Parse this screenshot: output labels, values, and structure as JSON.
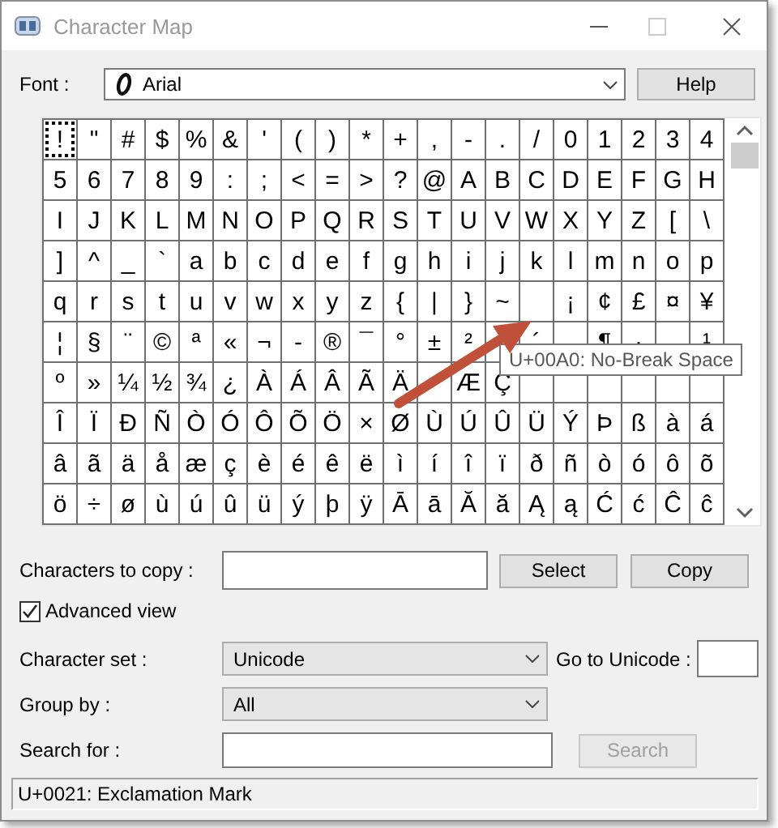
{
  "window": {
    "title": "Character Map"
  },
  "font": {
    "label": "Font :",
    "value": "Arial"
  },
  "help_button": {
    "label": "Help"
  },
  "grid": {
    "rows": [
      {
        "cells": [
          {
            "char": "!",
            "selected": true
          },
          {
            "char": "\"",
            "selected": false
          },
          {
            "char": "#",
            "selected": false
          },
          {
            "char": "$",
            "selected": false
          },
          {
            "char": "%",
            "selected": false
          },
          {
            "char": "&",
            "selected": false
          },
          {
            "char": "'",
            "selected": false
          },
          {
            "char": "(",
            "selected": false
          },
          {
            "char": ")",
            "selected": false
          },
          {
            "char": "*",
            "selected": false
          },
          {
            "char": "+",
            "selected": false
          },
          {
            "char": ",",
            "selected": false
          },
          {
            "char": "-",
            "selected": false
          },
          {
            "char": ".",
            "selected": false
          },
          {
            "char": "/",
            "selected": false
          },
          {
            "char": "0",
            "selected": false
          },
          {
            "char": "1",
            "selected": false
          },
          {
            "char": "2",
            "selected": false
          },
          {
            "char": "3",
            "selected": false
          },
          {
            "char": "4",
            "selected": false
          }
        ]
      },
      {
        "cells": [
          {
            "char": "5",
            "selected": false
          },
          {
            "char": "6",
            "selected": false
          },
          {
            "char": "7",
            "selected": false
          },
          {
            "char": "8",
            "selected": false
          },
          {
            "char": "9",
            "selected": false
          },
          {
            "char": ":",
            "selected": false
          },
          {
            "char": ";",
            "selected": false
          },
          {
            "char": "<",
            "selected": false
          },
          {
            "char": "=",
            "selected": false
          },
          {
            "char": ">",
            "selected": false
          },
          {
            "char": "?",
            "selected": false
          },
          {
            "char": "@",
            "selected": false
          },
          {
            "char": "A",
            "selected": false
          },
          {
            "char": "B",
            "selected": false
          },
          {
            "char": "C",
            "selected": false
          },
          {
            "char": "D",
            "selected": false
          },
          {
            "char": "E",
            "selected": false
          },
          {
            "char": "F",
            "selected": false
          },
          {
            "char": "G",
            "selected": false
          },
          {
            "char": "H",
            "selected": false
          }
        ]
      },
      {
        "cells": [
          {
            "char": "I",
            "selected": false
          },
          {
            "char": "J",
            "selected": false
          },
          {
            "char": "K",
            "selected": false
          },
          {
            "char": "L",
            "selected": false
          },
          {
            "char": "M",
            "selected": false
          },
          {
            "char": "N",
            "selected": false
          },
          {
            "char": "O",
            "selected": false
          },
          {
            "char": "P",
            "selected": false
          },
          {
            "char": "Q",
            "selected": false
          },
          {
            "char": "R",
            "selected": false
          },
          {
            "char": "S",
            "selected": false
          },
          {
            "char": "T",
            "selected": false
          },
          {
            "char": "U",
            "selected": false
          },
          {
            "char": "V",
            "selected": false
          },
          {
            "char": "W",
            "selected": false
          },
          {
            "char": "X",
            "selected": false
          },
          {
            "char": "Y",
            "selected": false
          },
          {
            "char": "Z",
            "selected": false
          },
          {
            "char": "[",
            "selected": false
          },
          {
            "char": "\\",
            "selected": false
          }
        ]
      },
      {
        "cells": [
          {
            "char": "]",
            "selected": false
          },
          {
            "char": "^",
            "selected": false
          },
          {
            "char": "_",
            "selected": false
          },
          {
            "char": "`",
            "selected": false
          },
          {
            "char": "a",
            "selected": false
          },
          {
            "char": "b",
            "selected": false
          },
          {
            "char": "c",
            "selected": false
          },
          {
            "char": "d",
            "selected": false
          },
          {
            "char": "e",
            "selected": false
          },
          {
            "char": "f",
            "selected": false
          },
          {
            "char": "g",
            "selected": false
          },
          {
            "char": "h",
            "selected": false
          },
          {
            "char": "i",
            "selected": false
          },
          {
            "char": "j",
            "selected": false
          },
          {
            "char": "k",
            "selected": false
          },
          {
            "char": "l",
            "selected": false
          },
          {
            "char": "m",
            "selected": false
          },
          {
            "char": "n",
            "selected": false
          },
          {
            "char": "o",
            "selected": false
          },
          {
            "char": "p",
            "selected": false
          }
        ]
      },
      {
        "cells": [
          {
            "char": "q",
            "selected": false
          },
          {
            "char": "r",
            "selected": false
          },
          {
            "char": "s",
            "selected": false
          },
          {
            "char": "t",
            "selected": false
          },
          {
            "char": "u",
            "selected": false
          },
          {
            "char": "v",
            "selected": false
          },
          {
            "char": "w",
            "selected": false
          },
          {
            "char": "x",
            "selected": false
          },
          {
            "char": "y",
            "selected": false
          },
          {
            "char": "z",
            "selected": false
          },
          {
            "char": "{",
            "selected": false
          },
          {
            "char": "|",
            "selected": false
          },
          {
            "char": "}",
            "selected": false
          },
          {
            "char": "~",
            "selected": false
          },
          {
            "selected": false
          },
          {
            "char": "¡",
            "selected": false
          },
          {
            "char": "¢",
            "selected": false
          },
          {
            "char": "£",
            "selected": false
          },
          {
            "char": "¤",
            "selected": false
          },
          {
            "char": "¥",
            "selected": false
          }
        ]
      },
      {
        "cells": [
          {
            "char": "¦",
            "selected": false
          },
          {
            "char": "§",
            "selected": false
          },
          {
            "char": "¨",
            "selected": false
          },
          {
            "char": "©",
            "selected": false
          },
          {
            "char": "ª",
            "selected": false
          },
          {
            "char": "«",
            "selected": false
          },
          {
            "char": "¬",
            "selected": false
          },
          {
            "char": "-",
            "selected": false
          },
          {
            "char": "®",
            "selected": false
          },
          {
            "char": "¯",
            "selected": false
          },
          {
            "char": "°",
            "selected": false
          },
          {
            "char": "±",
            "selected": false
          },
          {
            "char": "²",
            "selected": false
          },
          {
            "selected": false
          },
          {
            "char": "´",
            "selected": false
          },
          {
            "selected": false
          },
          {
            "char": "¶",
            "selected": false
          },
          {
            "char": "·",
            "selected": false
          },
          {
            "selected": false
          },
          {
            "char": "¹",
            "selected": false
          }
        ]
      },
      {
        "cells": [
          {
            "char": "º",
            "selected": false
          },
          {
            "char": "»",
            "selected": false
          },
          {
            "char": "¼",
            "selected": false
          },
          {
            "char": "½",
            "selected": false
          },
          {
            "char": "¾",
            "selected": false
          },
          {
            "char": "¿",
            "selected": false
          },
          {
            "char": "À",
            "selected": false
          },
          {
            "char": "Á",
            "selected": false
          },
          {
            "char": "Â",
            "selected": false
          },
          {
            "char": "Ã",
            "selected": false
          },
          {
            "char": "Ä",
            "selected": false
          },
          {
            "selected": false
          },
          {
            "char": "Æ",
            "selected": false
          },
          {
            "char": "Ç",
            "selected": false
          },
          {
            "selected": false
          },
          {
            "selected": false
          },
          {
            "selected": false
          },
          {
            "selected": false
          },
          {
            "selected": false
          },
          {
            "selected": false
          }
        ]
      },
      {
        "cells": [
          {
            "char": "Î",
            "selected": false
          },
          {
            "char": "Ï",
            "selected": false
          },
          {
            "char": "Ð",
            "selected": false
          },
          {
            "char": "Ñ",
            "selected": false
          },
          {
            "char": "Ò",
            "selected": false
          },
          {
            "char": "Ó",
            "selected": false
          },
          {
            "char": "Ô",
            "selected": false
          },
          {
            "char": "Õ",
            "selected": false
          },
          {
            "char": "Ö",
            "selected": false
          },
          {
            "char": "×",
            "selected": false
          },
          {
            "char": "Ø",
            "selected": false
          },
          {
            "char": "Ù",
            "selected": false
          },
          {
            "char": "Ú",
            "selected": false
          },
          {
            "char": "Û",
            "selected": false
          },
          {
            "char": "Ü",
            "selected": false
          },
          {
            "char": "Ý",
            "selected": false
          },
          {
            "char": "Þ",
            "selected": false
          },
          {
            "char": "ß",
            "selected": false
          },
          {
            "char": "à",
            "selected": false
          },
          {
            "char": "á",
            "selected": false
          }
        ]
      },
      {
        "cells": [
          {
            "char": "â",
            "selected": false
          },
          {
            "char": "ã",
            "selected": false
          },
          {
            "char": "ä",
            "selected": false
          },
          {
            "char": "å",
            "selected": false
          },
          {
            "char": "æ",
            "selected": false
          },
          {
            "char": "ç",
            "selected": false
          },
          {
            "char": "è",
            "selected": false
          },
          {
            "char": "é",
            "selected": false
          },
          {
            "char": "ê",
            "selected": false
          },
          {
            "char": "ë",
            "selected": false
          },
          {
            "char": "ì",
            "selected": false
          },
          {
            "char": "í",
            "selected": false
          },
          {
            "char": "î",
            "selected": false
          },
          {
            "char": "ï",
            "selected": false
          },
          {
            "char": "ð",
            "selected": false
          },
          {
            "char": "ñ",
            "selected": false
          },
          {
            "char": "ò",
            "selected": false
          },
          {
            "char": "ó",
            "selected": false
          },
          {
            "char": "ô",
            "selected": false
          },
          {
            "char": "õ",
            "selected": false
          }
        ]
      },
      {
        "cells": [
          {
            "char": "ö",
            "selected": false
          },
          {
            "char": "÷",
            "selected": false
          },
          {
            "char": "ø",
            "selected": false
          },
          {
            "char": "ù",
            "selected": false
          },
          {
            "char": "ú",
            "selected": false
          },
          {
            "char": "û",
            "selected": false
          },
          {
            "char": "ü",
            "selected": false
          },
          {
            "char": "ý",
            "selected": false
          },
          {
            "char": "þ",
            "selected": false
          },
          {
            "char": "ÿ",
            "selected": false
          },
          {
            "char": "Ā",
            "selected": false
          },
          {
            "char": "ā",
            "selected": false
          },
          {
            "char": "Ă",
            "selected": false
          },
          {
            "char": "ă",
            "selected": false
          },
          {
            "char": "Ą",
            "selected": false
          },
          {
            "char": "ą",
            "selected": false
          },
          {
            "char": "Ć",
            "selected": false
          },
          {
            "char": "ć",
            "selected": false
          },
          {
            "char": "Ĉ",
            "selected": false
          },
          {
            "char": "ĉ",
            "selected": false
          }
        ]
      }
    ]
  },
  "tooltip": "U+00A0: No-Break Space",
  "characters_to_copy": {
    "label": "Characters to copy :"
  },
  "select_button": {
    "label": "Select"
  },
  "copy_button": {
    "label": "Copy"
  },
  "advanced_view": {
    "label": "Advanced view",
    "checked": true
  },
  "character_set": {
    "label": "Character set :",
    "value": "Unicode"
  },
  "go_to_unicode": {
    "label": "Go to Unicode :"
  },
  "group_by": {
    "label": "Group by :",
    "value": "All"
  },
  "search_for": {
    "label": "Search for :"
  },
  "search_button": {
    "label": "Search",
    "disabled": true
  },
  "status_bar": "U+0021: Exclamation Mark"
}
